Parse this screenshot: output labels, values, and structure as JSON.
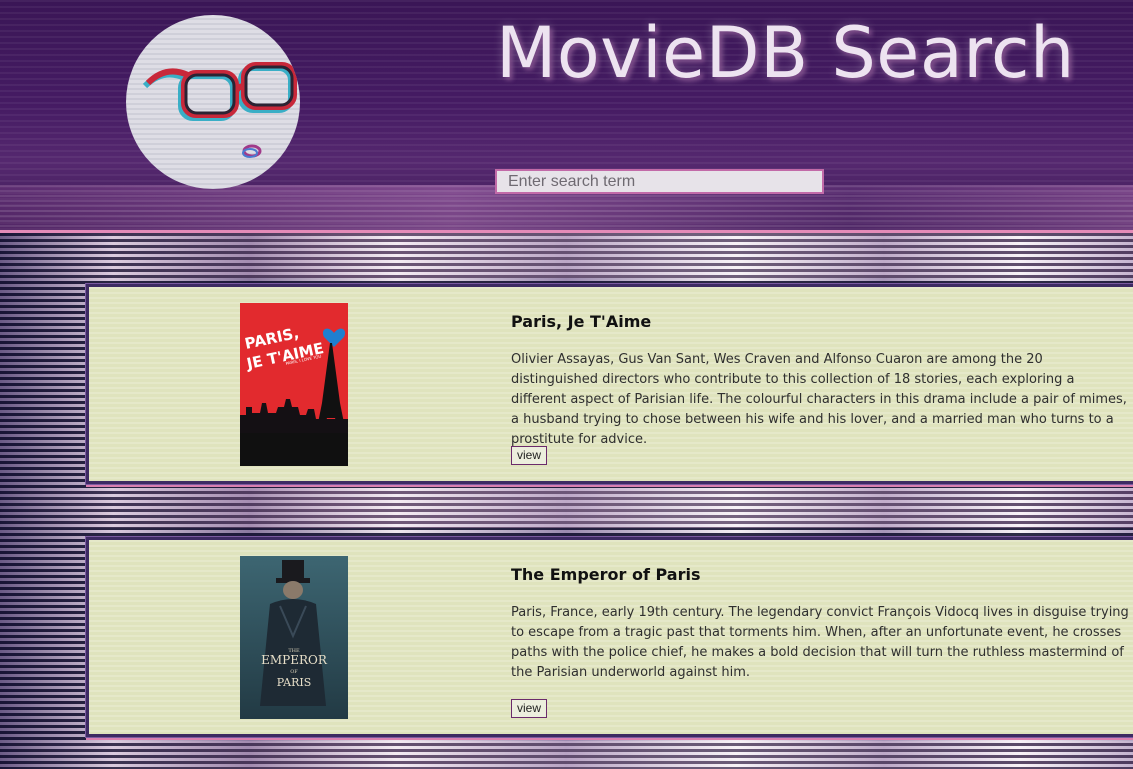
{
  "header": {
    "title": "MovieDB Search",
    "logo_icon": "glasses-logo-icon"
  },
  "search": {
    "placeholder": "Enter search term",
    "value": ""
  },
  "results": [
    {
      "title": "Paris, Je T'Aime",
      "overview": "Olivier Assayas, Gus Van Sant, Wes Craven and Alfonso Cuaron are among the 20 distinguished directors who contribute to this collection of 18 stories, each exploring a different aspect of Parisian life. The colourful characters in this drama include a pair of mimes, a husband trying to chose between his wife and his lover, and a married man who turns to a prostitute for advice.",
      "view_label": "view",
      "poster": {
        "title_line1": "PARIS,",
        "title_line2": "JE T'AIME",
        "tagline": "PARIS, I LOVE YOU",
        "background_color": "#e22a2e"
      }
    },
    {
      "title": "The Emperor of Paris",
      "overview": "Paris, France, early 19th century. The legendary convict François Vidocq lives in disguise trying to escape from a tragic past that torments him. When, after an unfortunate event, he crosses paths with the police chief, he makes a bold decision that will turn the ruthless mastermind of the Parisian underworld against him.",
      "view_label": "view",
      "poster": {
        "line1": "THE",
        "line2": "EMPEROR",
        "line3": "OF",
        "line4": "PARIS",
        "background_color": "#2f4e5a"
      }
    }
  ],
  "colors": {
    "header_bg": "#451b63",
    "card_bg": "#dfe3bd",
    "accent_pink": "#e48bb8",
    "card_border": "#3d2a63"
  }
}
